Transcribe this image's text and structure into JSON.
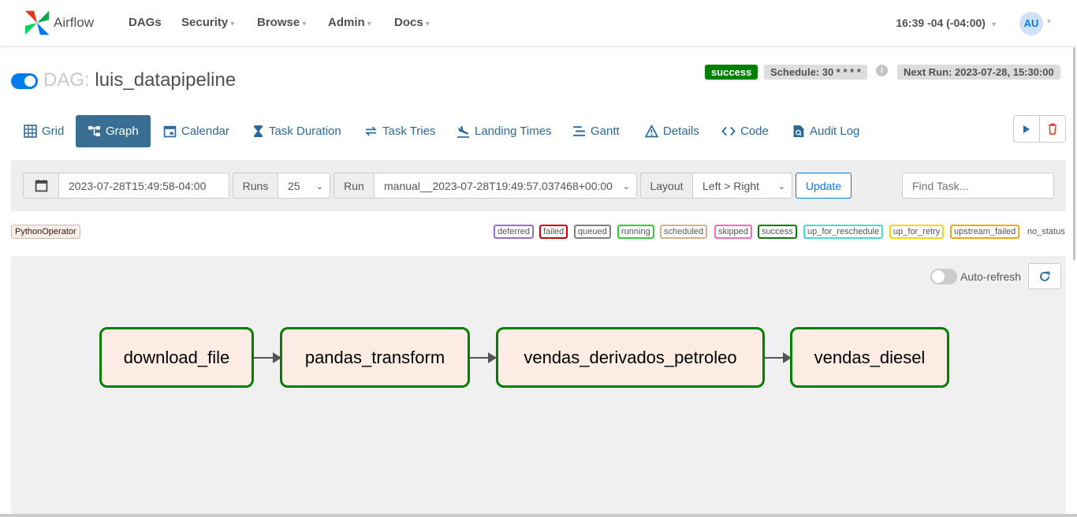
{
  "nav": {
    "brand": "Airflow",
    "items": [
      "DAGs",
      "Security",
      "Browse",
      "Admin",
      "Docs"
    ],
    "time": "16:39 -04 (-04:00)",
    "user_initials": "AU"
  },
  "dag": {
    "prefix": "DAG:",
    "name": "luis_datapipeline",
    "status": "success",
    "schedule": "Schedule: 30 * * * *",
    "next_run": "Next Run: 2023-07-28, 15:30:00"
  },
  "tabs": [
    "Grid",
    "Graph",
    "Calendar",
    "Task Duration",
    "Task Tries",
    "Landing Times",
    "Gantt",
    "Details",
    "Code",
    "Audit Log"
  ],
  "active_tab": "Graph",
  "filters": {
    "base_date": "2023-07-28T15:49:58-04:00",
    "runs_label": "Runs",
    "runs_value": "25",
    "run_label": "Run",
    "run_value": "manual__2023-07-28T19:49:57.037468+00:00",
    "layout_label": "Layout",
    "layout_value": "Left > Right",
    "update_label": "Update",
    "find_placeholder": "Find Task..."
  },
  "operator": "PythonOperator",
  "legend": [
    {
      "label": "deferred",
      "color": "#9370db"
    },
    {
      "label": "failed",
      "color": "#cc0000"
    },
    {
      "label": "queued",
      "color": "#808080"
    },
    {
      "label": "running",
      "color": "#32cd32"
    },
    {
      "label": "scheduled",
      "color": "#d2b48c"
    },
    {
      "label": "skipped",
      "color": "#ff69b4"
    },
    {
      "label": "success",
      "color": "#008000"
    },
    {
      "label": "up_for_reschedule",
      "color": "#40e0d0"
    },
    {
      "label": "up_for_retry",
      "color": "#ffd700"
    },
    {
      "label": "upstream_failed",
      "color": "#ffa500"
    }
  ],
  "legend_no_status": "no_status",
  "autorefresh_label": "Auto-refresh",
  "tasks": [
    "download_file",
    "pandas_transform",
    "vendas_derivados_petroleo",
    "vendas_diesel"
  ]
}
